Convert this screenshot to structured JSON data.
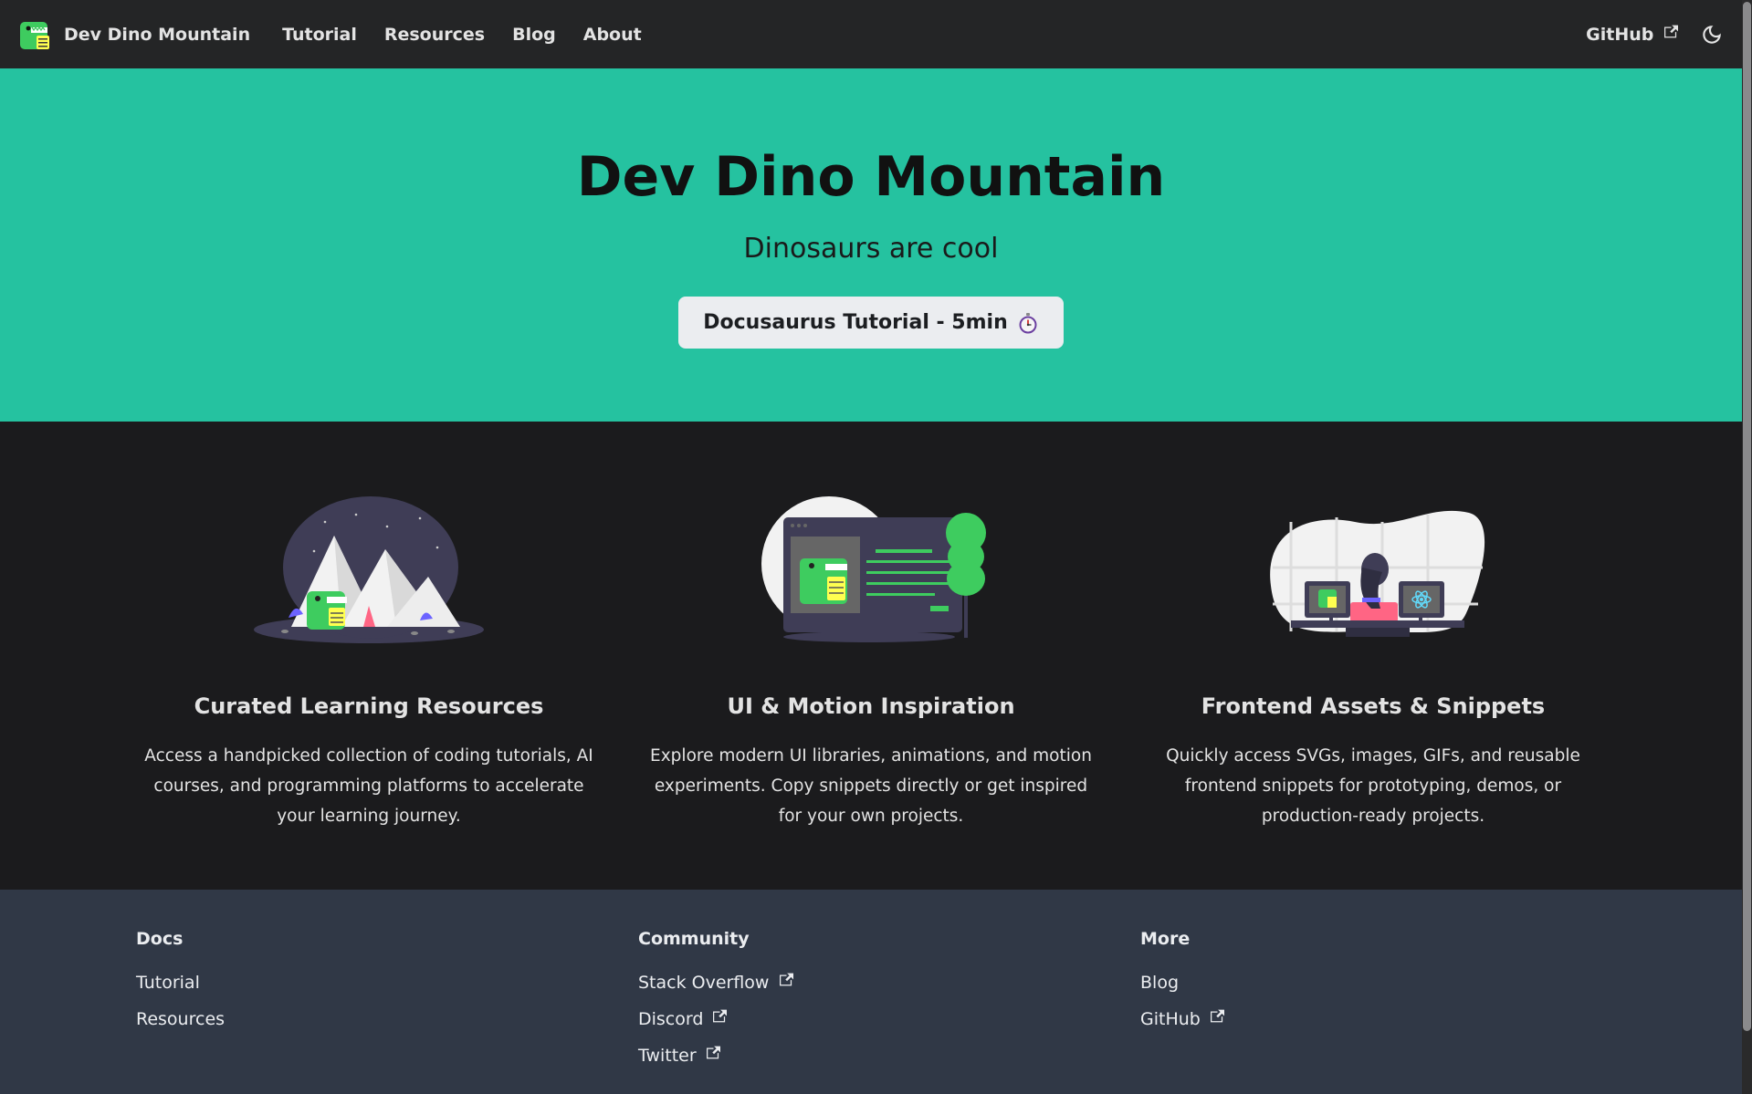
{
  "navbar": {
    "brand_title": "Dev Dino Mountain",
    "links": [
      "Tutorial",
      "Resources",
      "Blog",
      "About"
    ],
    "github_label": "GitHub",
    "theme_toggle_icon": "moon-icon"
  },
  "hero": {
    "title": "Dev Dino Mountain",
    "subtitle": "Dinosaurs are cool",
    "button_label": "Docusaurus Tutorial - 5min",
    "button_icon": "stopwatch-icon",
    "background_color": "#25c2a0"
  },
  "features": [
    {
      "illustration": "dino-mountain-illustration",
      "title": "Curated Learning Resources",
      "text": "Access a handpicked collection of coding tutorials, AI courses, and programming platforms to accelerate your learning journey."
    },
    {
      "illustration": "dino-tree-illustration",
      "title": "UI & Motion Inspiration",
      "text": "Explore modern UI libraries, animations, and motion experiments. Copy snippets directly or get inspired for your own projects."
    },
    {
      "illustration": "dino-react-illustration",
      "title": "Frontend Assets & Snippets",
      "text": "Quickly access SVGs, images, GIFs, and reusable frontend snippets for prototyping, demos, or production-ready projects."
    }
  ],
  "footer": {
    "columns": [
      {
        "title": "Docs",
        "links": [
          "Tutorial",
          "Resources"
        ]
      },
      {
        "title": "Community",
        "links": [
          "Stack Overflow",
          "Discord",
          "Twitter"
        ]
      },
      {
        "title": "More",
        "links": [
          "Blog",
          "GitHub"
        ]
      }
    ]
  },
  "colors": {
    "navbar_bg": "#242526",
    "page_bg": "#1b1b1d",
    "footer_bg": "#303846",
    "accent": "#25c2a0"
  }
}
